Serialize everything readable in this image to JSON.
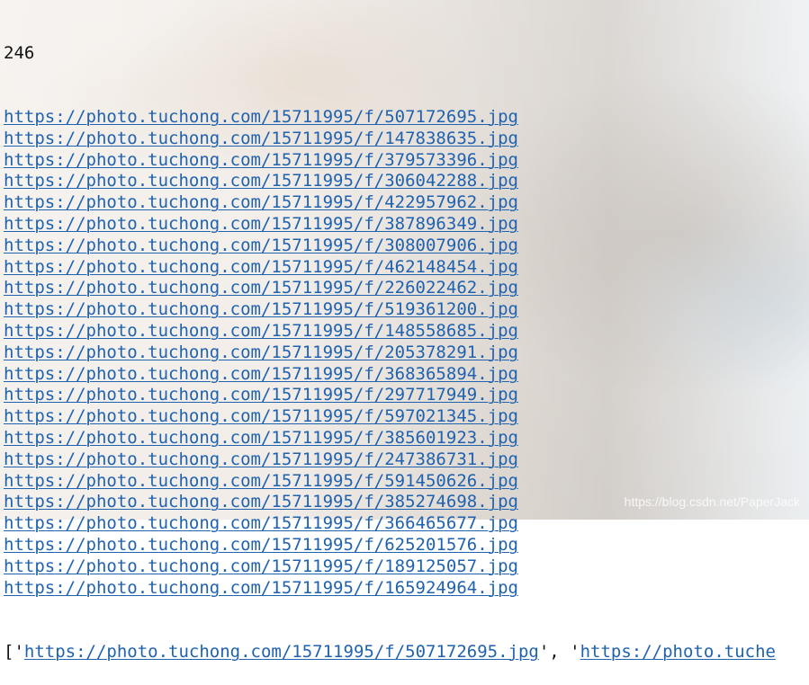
{
  "output": {
    "count": "246",
    "urls": [
      "https://photo.tuchong.com/15711995/f/507172695.jpg",
      "https://photo.tuchong.com/15711995/f/147838635.jpg",
      "https://photo.tuchong.com/15711995/f/379573396.jpg",
      "https://photo.tuchong.com/15711995/f/306042288.jpg",
      "https://photo.tuchong.com/15711995/f/422957962.jpg",
      "https://photo.tuchong.com/15711995/f/387896349.jpg",
      "https://photo.tuchong.com/15711995/f/308007906.jpg",
      "https://photo.tuchong.com/15711995/f/462148454.jpg",
      "https://photo.tuchong.com/15711995/f/226022462.jpg",
      "https://photo.tuchong.com/15711995/f/519361200.jpg",
      "https://photo.tuchong.com/15711995/f/148558685.jpg",
      "https://photo.tuchong.com/15711995/f/205378291.jpg",
      "https://photo.tuchong.com/15711995/f/368365894.jpg",
      "https://photo.tuchong.com/15711995/f/297717949.jpg",
      "https://photo.tuchong.com/15711995/f/597021345.jpg",
      "https://photo.tuchong.com/15711995/f/385601923.jpg",
      "https://photo.tuchong.com/15711995/f/247386731.jpg",
      "https://photo.tuchong.com/15711995/f/591450626.jpg",
      "https://photo.tuchong.com/15711995/f/385274698.jpg",
      "https://photo.tuchong.com/15711995/f/366465677.jpg",
      "https://photo.tuchong.com/15711995/f/625201576.jpg",
      "https://photo.tuchong.com/15711995/f/189125057.jpg",
      "https://photo.tuchong.com/15711995/f/165924964.jpg"
    ],
    "list_line": {
      "open": "['",
      "first_url": "https://photo.tuchong.com/15711995/f/507172695.jpg",
      "separator": "', '",
      "second_url": "https://photo.tuche"
    }
  },
  "watermark": "https://blog.csdn.net/PaperJack",
  "colors": {
    "link": "#1f62b0",
    "text": "#111111"
  }
}
